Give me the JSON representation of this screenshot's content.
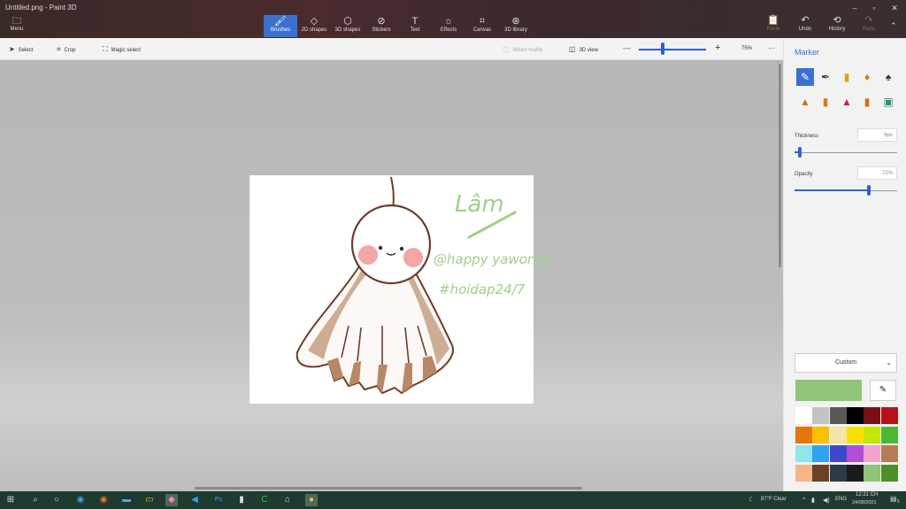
{
  "window": {
    "title": "Untitled.png - Paint 3D",
    "menu_label": "Menu",
    "controls": {
      "minimize": "–",
      "maximize": "▫",
      "close": "✕"
    }
  },
  "ribbon": {
    "tabs": [
      {
        "label": "Brushes",
        "icon": "brush-icon",
        "glyph": "🖌"
      },
      {
        "label": "2D shapes",
        "icon": "2d-shapes-icon",
        "glyph": "◇"
      },
      {
        "label": "3D shapes",
        "icon": "3d-shapes-icon",
        "glyph": "⬡"
      },
      {
        "label": "Stickers",
        "icon": "stickers-icon",
        "glyph": "⊘"
      },
      {
        "label": "Text",
        "icon": "text-icon",
        "glyph": "T"
      },
      {
        "label": "Effects",
        "icon": "effects-icon",
        "glyph": "☼"
      },
      {
        "label": "Canvas",
        "icon": "canvas-icon",
        "glyph": "⌗"
      },
      {
        "label": "3D library",
        "icon": "3d-library-icon",
        "glyph": "⊛"
      }
    ],
    "active_tab": "Brushes",
    "paste": "Paste",
    "undo": "Undo",
    "history": "History",
    "redo": "Redo"
  },
  "toolbar": {
    "select": "Select",
    "crop": "Crop",
    "magic_select": "Magic select",
    "mixed_reality": "Mixed reality",
    "view_3d": "3D view",
    "zoom": "75%",
    "zoom_level": 0.35,
    "more": "···"
  },
  "artwork": {
    "signature": "Lâm",
    "handle": "@happy yaworldo",
    "hashtag": "#hoidap24/7"
  },
  "panel": {
    "title": "Marker",
    "thickness_label": "Thickness",
    "thickness_value": "6px",
    "thickness_level": 0.05,
    "opacity_label": "Opacity",
    "opacity_value": "72%",
    "opacity_level": 0.72,
    "custom_label": "Custom",
    "current_color": "#8fc479",
    "palette": [
      "#ffffff",
      "#c3c3c3",
      "#585858",
      "#000000",
      "#7a1016",
      "#b5121b",
      "#e4760a",
      "#f7c100",
      "#f3e5a8",
      "#f5e000",
      "#c4e600",
      "#49b835",
      "#8fe6ec",
      "#32a2f0",
      "#3f48cc",
      "#b04fd6",
      "#f2a3cd",
      "#b87c52",
      "#f5b585",
      "#6b4226",
      "#2e3a45",
      "#1b1b1b",
      "#8fc479",
      "#4e8f2a"
    ]
  },
  "taskbar": {
    "weather": "87°F  Clear",
    "lang": "ENG",
    "time": "12:21 CH",
    "date": "24/08/2021",
    "notification_count": "5"
  }
}
